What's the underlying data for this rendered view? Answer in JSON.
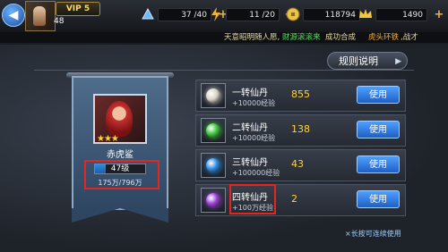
{
  "player": {
    "vip": "VIP 5",
    "level": "48"
  },
  "resources": [
    {
      "icon": "stamina-icon",
      "value": "37 /40",
      "color": "#6fb7ff"
    },
    {
      "icon": "lightning-icon",
      "value": "11 /20",
      "color": "#f0b23a"
    },
    {
      "icon": "coin-icon",
      "value": "118794",
      "color": "#e8c24a"
    },
    {
      "icon": "crown-icon",
      "value": "1490",
      "color": "#f3c53b"
    }
  ],
  "ticker": {
    "part1": "天意昭明随人愿,",
    "part2": "财源滚滚来",
    "part3": "成功合成",
    "part4": "虎头环铁",
    "part5": ",战才"
  },
  "panel": {
    "rules_label": "规则说明",
    "hero_name": "赤虎鲨",
    "hero_stars": "★★★",
    "hero_level": "47级",
    "hero_level_progress": 0.22,
    "hero_exp": "175万/796万"
  },
  "items": [
    {
      "name": "一转仙丹",
      "exp": "+10000经验",
      "count": "855",
      "orb_color": "#d7d3c7",
      "button": "使用"
    },
    {
      "name": "二转仙丹",
      "exp": "+10000经验",
      "count": "138",
      "orb_color": "#3ec43a",
      "button": "使用"
    },
    {
      "name": "三转仙丹",
      "exp": "+100000经验",
      "count": "43",
      "orb_color": "#2d8be0",
      "button": "使用"
    },
    {
      "name": "四转仙丹",
      "exp": "+100万经验",
      "count": "2",
      "orb_color": "#9a3fd6",
      "button": "使用"
    }
  ],
  "hint": "×长按可连续使用"
}
